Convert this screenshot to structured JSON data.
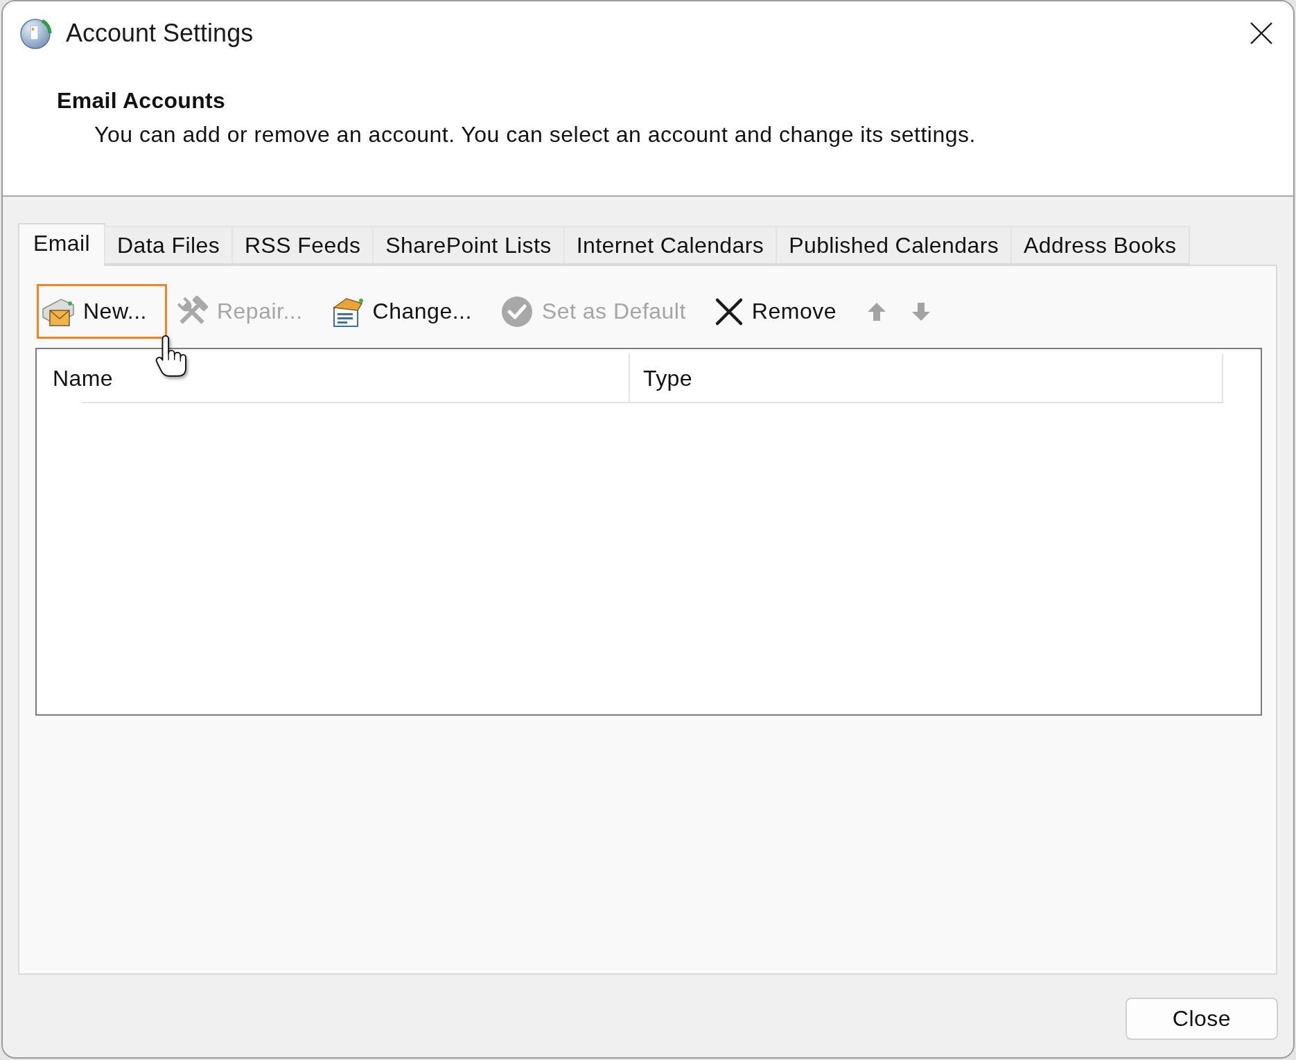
{
  "window": {
    "title": "Account Settings"
  },
  "header": {
    "heading": "Email Accounts",
    "description": "You can add or remove an account. You can select an account and change its settings."
  },
  "tabs": [
    {
      "label": "Email",
      "selected": true
    },
    {
      "label": "Data Files",
      "selected": false
    },
    {
      "label": "RSS Feeds",
      "selected": false
    },
    {
      "label": "SharePoint Lists",
      "selected": false
    },
    {
      "label": "Internet Calendars",
      "selected": false
    },
    {
      "label": "Published Calendars",
      "selected": false
    },
    {
      "label": "Address Books",
      "selected": false
    }
  ],
  "toolbar": [
    {
      "kind": "new",
      "label": "New...",
      "disabled": false,
      "highlighted": true
    },
    {
      "kind": "repair",
      "label": "Repair...",
      "disabled": true,
      "highlighted": false
    },
    {
      "kind": "change",
      "label": "Change...",
      "disabled": false,
      "highlighted": false
    },
    {
      "kind": "set_default",
      "label": "Set as Default",
      "disabled": true,
      "highlighted": false
    },
    {
      "kind": "remove",
      "label": "Remove",
      "disabled": false,
      "highlighted": false
    },
    {
      "kind": "move_up",
      "disabled": true,
      "highlighted": false
    },
    {
      "kind": "move_down",
      "disabled": true,
      "highlighted": false
    }
  ],
  "accounts_list": {
    "columns": [
      "Name",
      "Type"
    ]
  },
  "footer": {
    "close_button": "Close"
  }
}
